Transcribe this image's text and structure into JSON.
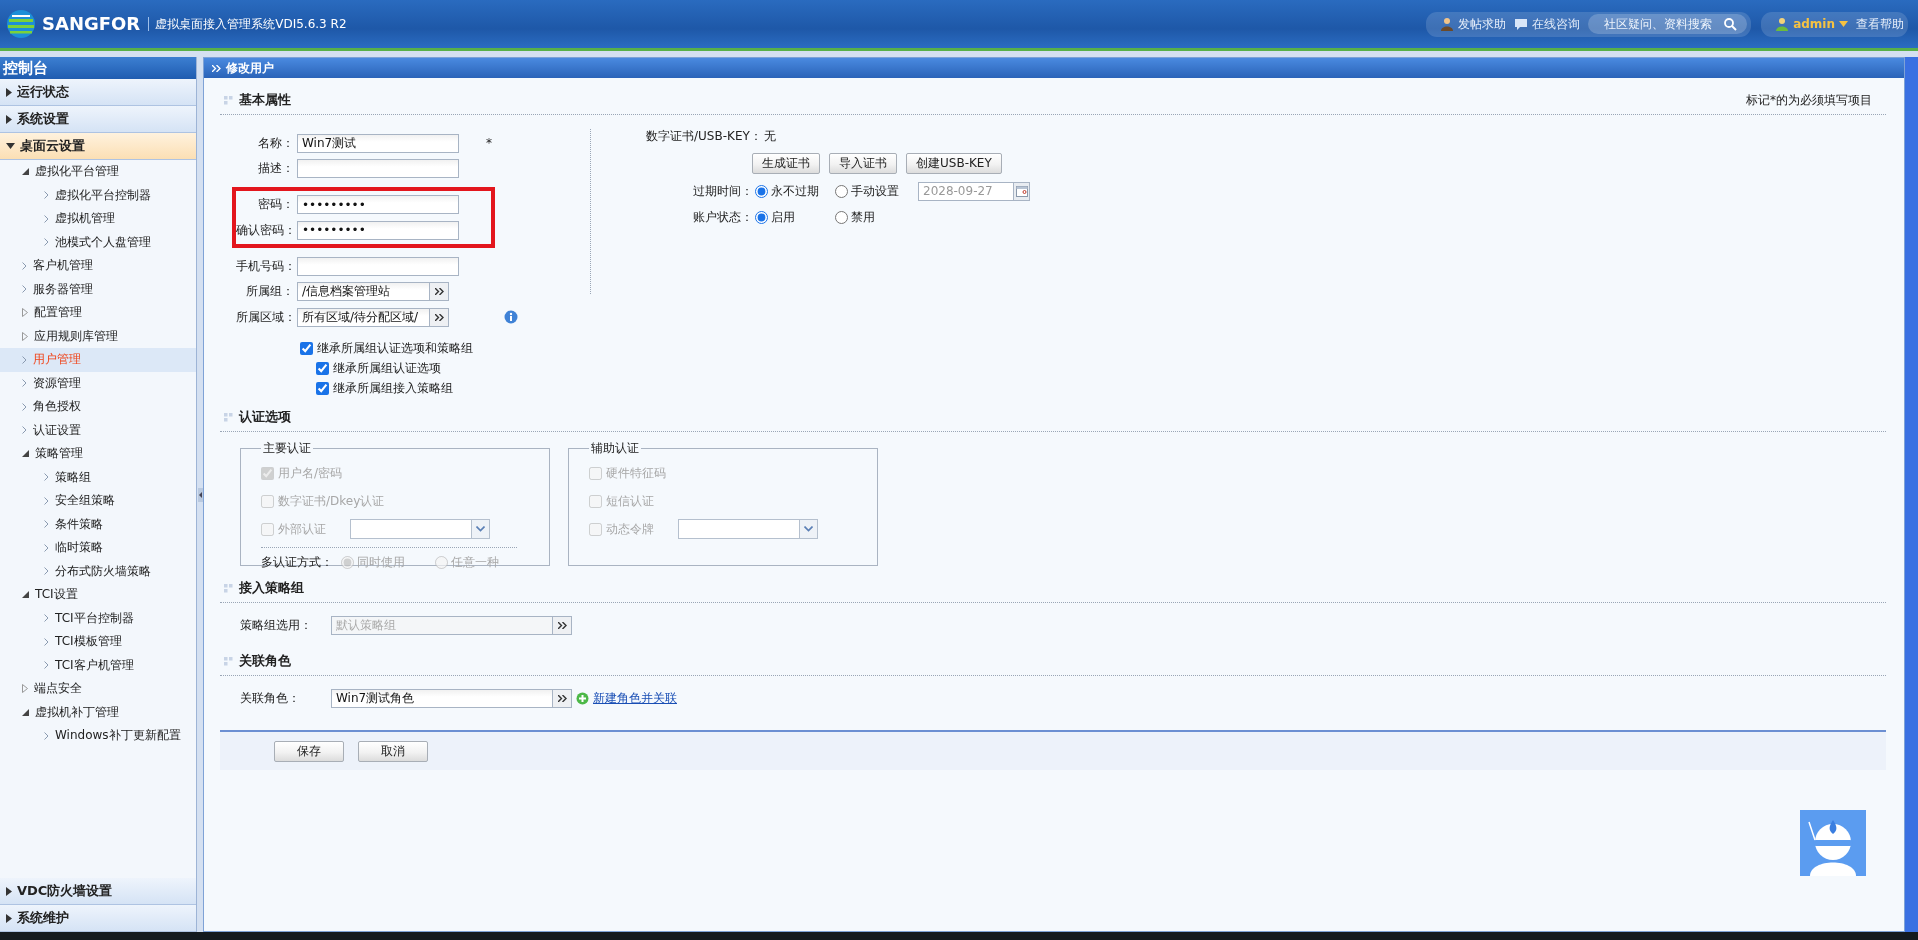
{
  "header": {
    "brand": "SANGFOR",
    "system_title": "虚拟桌面接入管理系统VDI5.6.3 R2",
    "links": [
      {
        "label": "发帖求助",
        "kind": "person"
      },
      {
        "label": "在线咨询",
        "kind": "chat"
      }
    ],
    "search": {
      "placeholder": "社区疑问、资料搜索"
    },
    "user": "admin",
    "help": "查看帮助"
  },
  "sidebar": {
    "title": "控制台",
    "sections": [
      {
        "label": "运行状态",
        "expanded": false
      },
      {
        "label": "系统设置",
        "expanded": false
      },
      {
        "label": "桌面云设置",
        "expanded": true,
        "items": [
          {
            "label": "虚拟化平台管理",
            "kind": "group",
            "expanded": true,
            "selected": false,
            "children": [
              {
                "label": "虚拟化平台控制器",
                "kind": "leaf",
                "selected": false
              },
              {
                "label": "虚拟机管理",
                "kind": "leaf",
                "selected": false
              },
              {
                "label": "池模式个人盘管理",
                "kind": "leaf",
                "selected": false
              }
            ]
          },
          {
            "label": "客户机管理",
            "kind": "leaf",
            "selected": false
          },
          {
            "label": "服务器管理",
            "kind": "leaf",
            "selected": false
          },
          {
            "label": "配置管理",
            "kind": "group",
            "expanded": false,
            "selected": false
          },
          {
            "label": "应用规则库管理",
            "kind": "group",
            "expanded": false,
            "selected": false
          },
          {
            "label": "用户管理",
            "kind": "leaf",
            "selected": true
          },
          {
            "label": "资源管理",
            "kind": "leaf",
            "selected": false
          },
          {
            "label": "角色授权",
            "kind": "leaf",
            "selected": false
          },
          {
            "label": "认证设置",
            "kind": "leaf",
            "selected": false
          },
          {
            "label": "策略管理",
            "kind": "group",
            "expanded": true,
            "selected": false,
            "children": [
              {
                "label": "策略组",
                "kind": "leaf",
                "selected": false
              },
              {
                "label": "安全组策略",
                "kind": "leaf",
                "selected": false
              },
              {
                "label": "条件策略",
                "kind": "leaf",
                "selected": false
              },
              {
                "label": "临时策略",
                "kind": "leaf",
                "selected": false
              },
              {
                "label": "分布式防火墙策略",
                "kind": "leaf",
                "selected": false
              }
            ]
          },
          {
            "label": "TCI设置",
            "kind": "group",
            "expanded": true,
            "selected": false,
            "children": [
              {
                "label": "TCI平台控制器",
                "kind": "leaf",
                "selected": false
              },
              {
                "label": "TCI模板管理",
                "kind": "leaf",
                "selected": false
              },
              {
                "label": "TCI客户机管理",
                "kind": "leaf",
                "selected": false
              }
            ]
          },
          {
            "label": "端点安全",
            "kind": "group",
            "expanded": false,
            "selected": false
          },
          {
            "label": "虚拟机补丁管理",
            "kind": "group",
            "expanded": true,
            "selected": false,
            "children": [
              {
                "label": "Windows补丁更新配置",
                "kind": "leaf",
                "selected": false
              }
            ]
          }
        ]
      }
    ],
    "bottom_sections": [
      {
        "label": "VDC防火墙设置",
        "expanded": false
      },
      {
        "label": "系统维护",
        "expanded": false
      }
    ]
  },
  "page": {
    "title": "修改用户",
    "note": "标记*的为必须填写项目"
  },
  "basic": {
    "title": "基本属性",
    "fields": [
      {
        "label": "名称：",
        "kind": "text",
        "value": "Win7测试",
        "required_mark": "*"
      },
      {
        "label": "描述：",
        "kind": "text"
      },
      {
        "label": "密码：",
        "kind": "text",
        "value": "•••••••••",
        "highlighted": true
      },
      {
        "label": "确认密码：",
        "kind": "text",
        "value": "•••••••••",
        "highlighted": true
      },
      {
        "label": "手机号码：",
        "kind": "text"
      },
      {
        "label": "所属组：",
        "kind": "picker",
        "value": "/信息档案管理站"
      },
      {
        "label": "所属区域：",
        "kind": "picker",
        "value": "所有区域/待分配区域/",
        "info": true
      }
    ],
    "checkboxes": [
      {
        "label": "继承所属组认证选项和策略组",
        "checked": true,
        "children": [
          {
            "label": "继承所属组认证选项",
            "checked": true
          },
          {
            "label": "继承所属组接入策略组",
            "checked": true
          }
        ]
      }
    ],
    "certificate": {
      "label": "数字证书/USB-KEY：",
      "value": "无",
      "buttons": [
        "生成证书",
        "导入证书",
        "创建USB-KEY"
      ]
    },
    "expiry": {
      "label": "过期时间：",
      "options": [
        {
          "label": "永不过期",
          "selected": true
        },
        {
          "label": "手动设置",
          "selected": false
        }
      ],
      "date": "2028-09-27"
    },
    "status": {
      "label": "账户状态：",
      "options": [
        {
          "label": "启用",
          "selected": true
        },
        {
          "label": "禁用",
          "selected": false
        }
      ]
    }
  },
  "auth": {
    "title": "认证选项",
    "groups": [
      {
        "legend": "主要认证",
        "options": [
          {
            "label": "用户名/密码",
            "kind": "checkbox",
            "checked": true
          },
          {
            "label": "数字证书/Dkey认证",
            "kind": "checkbox",
            "checked": false
          },
          {
            "label": "外部认证",
            "kind": "checkbox_select",
            "checked": false
          }
        ],
        "multi": {
          "label": "多认证方式：",
          "options": [
            {
              "label": "同时使用",
              "selected": true
            },
            {
              "label": "任意一种",
              "selected": false
            }
          ]
        }
      },
      {
        "legend": "辅助认证",
        "options": [
          {
            "label": "硬件特征码",
            "kind": "checkbox",
            "checked": false
          },
          {
            "label": "短信认证",
            "kind": "checkbox",
            "checked": false
          },
          {
            "label": "动态令牌",
            "kind": "checkbox_select",
            "checked": false
          }
        ]
      }
    ]
  },
  "policy": {
    "title": "接入策略组",
    "label": "策略组选用：",
    "value": "默认策略组"
  },
  "role": {
    "title": "关联角色",
    "label": "关联角色：",
    "value": "Win7测试角色",
    "link": "新建角色并关联"
  },
  "actions": [
    "保存",
    "取消"
  ]
}
